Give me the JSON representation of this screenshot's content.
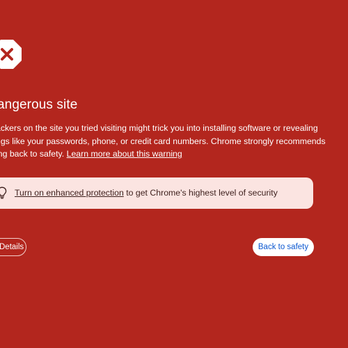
{
  "icon": {
    "name": "warning-x-icon",
    "background": "#ffffff",
    "glyph_color": "#b3261e"
  },
  "title": "angerous site",
  "body": {
    "line1": "ackers on the site you tried visiting might trick you into installing software or revealing",
    "line2": "ngs like your passwords, phone, or credit card numbers. Chrome strongly recommends",
    "line3_prefix": "ing back to safety. ",
    "learn_more_link": "Learn more about this warning"
  },
  "protection": {
    "icon": "lightbulb-icon",
    "link": "Turn on enhanced protection",
    "suffix": " to get Chrome's highest level of security"
  },
  "buttons": {
    "details": "Details",
    "back": "Back to safety"
  },
  "colors": {
    "background": "#b3261e",
    "accent_link": "#0b57d0",
    "info_box": "#fbe4e1"
  }
}
